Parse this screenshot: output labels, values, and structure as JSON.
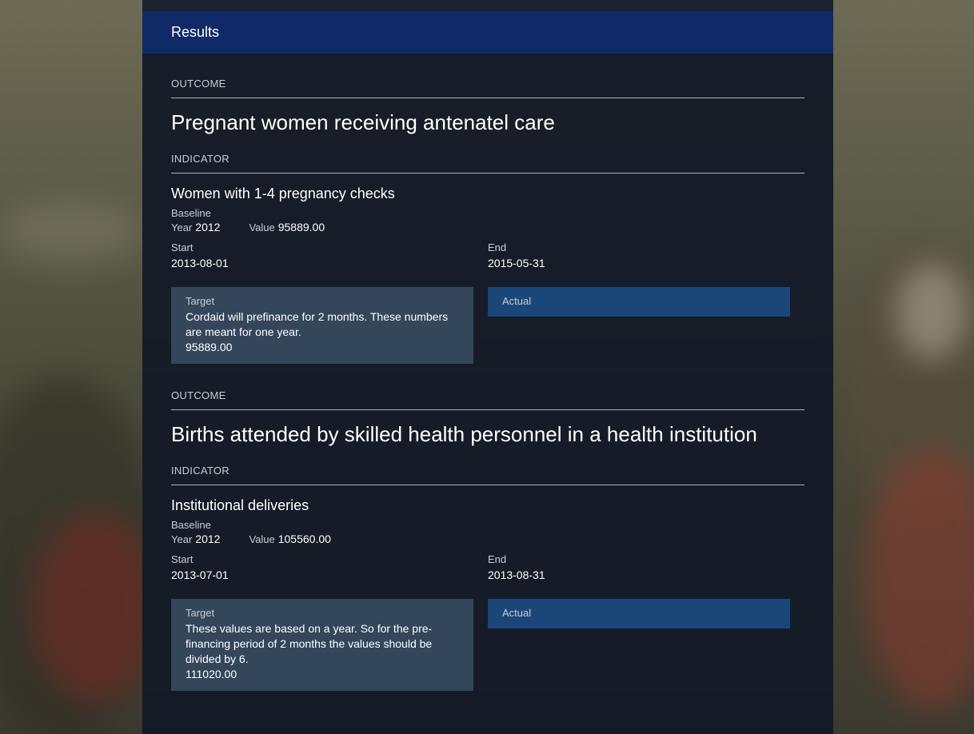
{
  "header": {
    "title": "Results"
  },
  "results": [
    {
      "outcome_label": "OUTCOME",
      "outcome_title": "Pregnant women receiving antenatel care",
      "indicator_label": "INDICATOR",
      "indicator_title": "Women with 1-4 pregnancy checks",
      "baseline_label": "Baseline",
      "year_label": "Year",
      "year": "2012",
      "value_label": "Value",
      "value": "95889.00",
      "start_label": "Start",
      "start": "2013-08-01",
      "end_label": "End",
      "end": "2015-05-31",
      "target_label": "Target",
      "target_comment": "Cordaid will prefinance for 2 months. These numbers are meant for one year.",
      "target_value": "95889.00",
      "actual_label": "Actual"
    },
    {
      "outcome_label": "OUTCOME",
      "outcome_title": "Births attended by skilled health personnel in a health institution",
      "indicator_label": "INDICATOR",
      "indicator_title": "Institutional deliveries",
      "baseline_label": "Baseline",
      "year_label": "Year",
      "year": "2012",
      "value_label": "Value",
      "value": "105560.00",
      "start_label": "Start",
      "start": "2013-07-01",
      "end_label": "End",
      "end": "2013-08-31",
      "target_label": "Target",
      "target_comment": "These values are based on a year. So for the pre-financing period of 2 months the values should be divided by 6.",
      "target_value": "111020.00",
      "actual_label": "Actual"
    }
  ]
}
